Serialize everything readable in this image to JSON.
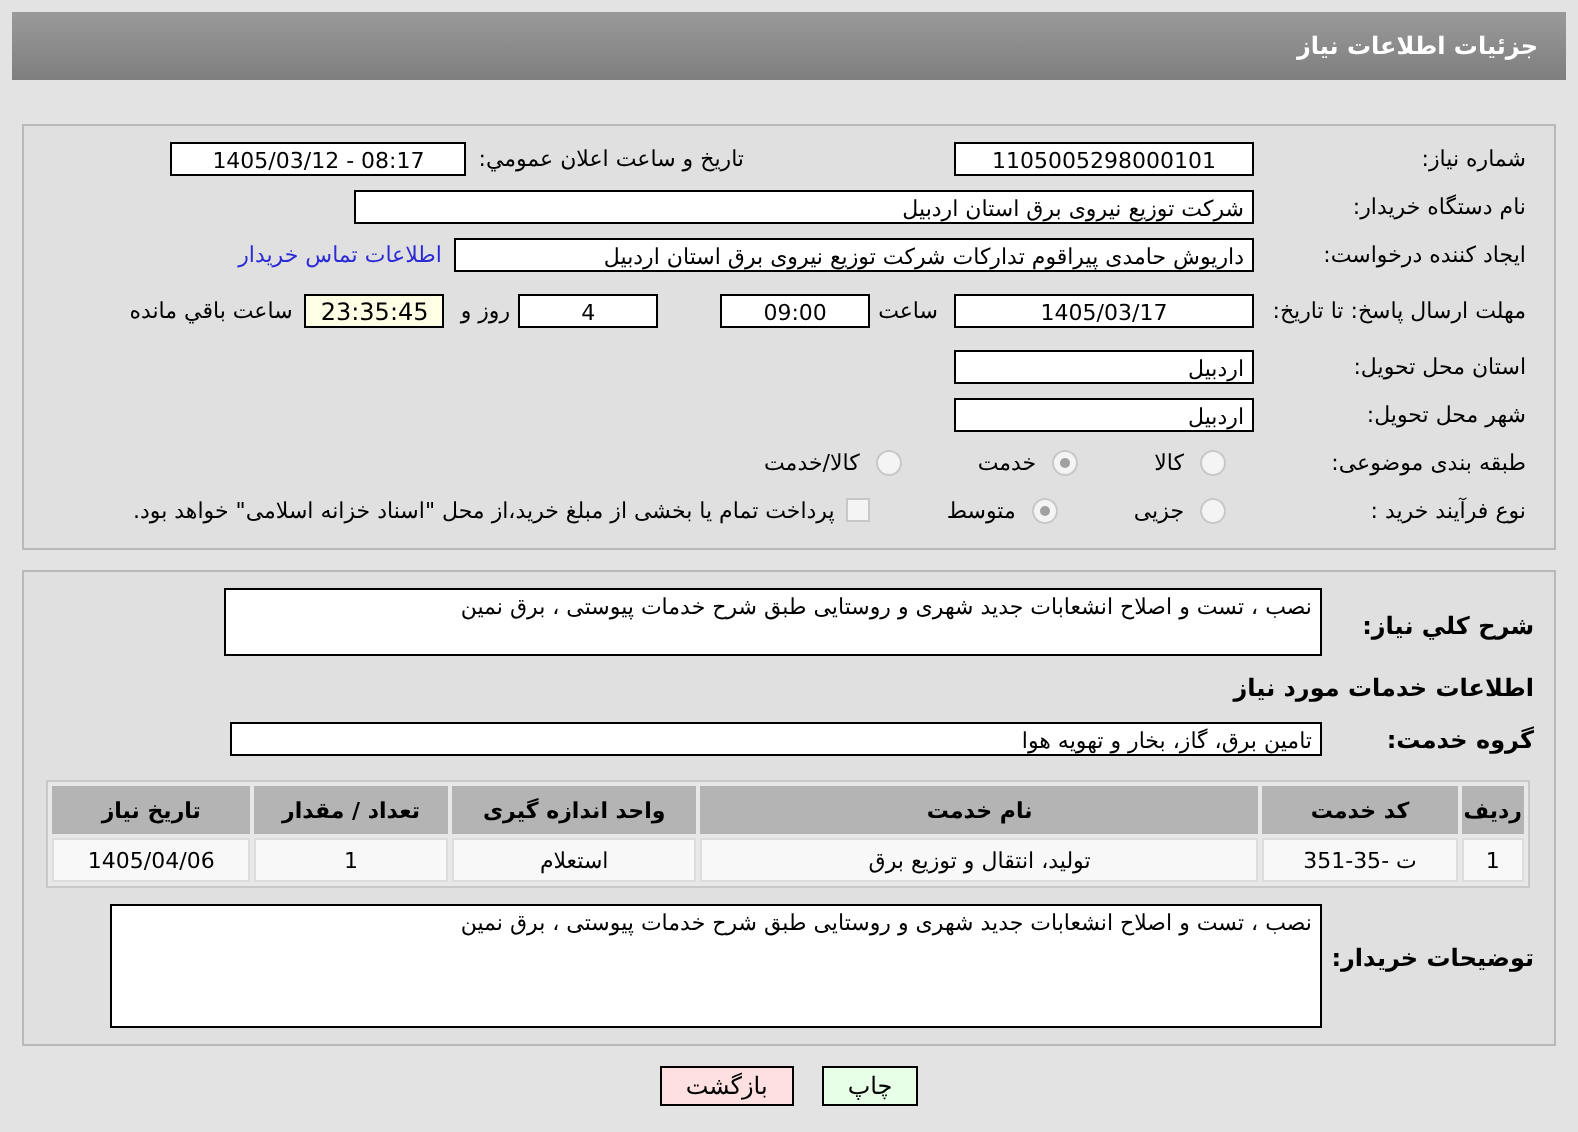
{
  "header": {
    "title": "جزئیات اطلاعات نیاز"
  },
  "details": {
    "need_number": {
      "label": "شماره نیاز:",
      "value": "1105005298000101"
    },
    "announce": {
      "label": "تاریخ و ساعت اعلان عمومي:",
      "value": "1405/03/12 - 08:17"
    },
    "buyer": {
      "label": "نام دستگاه خریدار:",
      "value": "شرکت توزیع نیروی برق استان اردبیل"
    },
    "creator": {
      "label": "ایجاد کننده درخواست:",
      "value": "داریوش حامدی پیراقوم تدارکات شرکت توزیع نیروی برق استان اردبیل",
      "link": "اطلاعات تماس خریدار"
    },
    "deadline": {
      "label": "مهلت ارسال پاسخ: تا تاریخ:",
      "date": "1405/03/17",
      "time_label": "ساعت",
      "time": "09:00",
      "days": "4",
      "days_label": "روز و",
      "remaining": "23:35:45",
      "remaining_label": "ساعت باقي مانده"
    },
    "province": {
      "label": "استان محل تحویل:",
      "value": "اردبیل"
    },
    "city": {
      "label": "شهر محل تحویل:",
      "value": "اردبیل"
    },
    "category": {
      "label": "طبقه بندی موضوعی:",
      "options": [
        {
          "label": "کالا",
          "selected": false
        },
        {
          "label": "خدمت",
          "selected": true
        },
        {
          "label": "کالا/خدمت",
          "selected": false
        }
      ]
    },
    "process": {
      "label": "نوع فرآیند خرید :",
      "options": [
        {
          "label": "جزیی",
          "selected": false
        },
        {
          "label": "متوسط",
          "selected": true
        }
      ],
      "treasury": {
        "label": "پرداخت تمام یا بخشی از مبلغ خرید،از محل \"اسناد خزانه اسلامی\" خواهد بود.",
        "checked": false
      }
    }
  },
  "services": {
    "summary": {
      "label": "شرح کلي نیاز:",
      "value": "نصب ، تست و اصلاح انشعابات جدید شهری و روستایی طبق شرح خدمات پیوستی ، برق نمین"
    },
    "heading": "اطلاعات خدمات مورد نیاز",
    "group": {
      "label": "گروه خدمت:",
      "value": "تامین برق، گاز، بخار و تهویه هوا"
    },
    "table": {
      "columns": [
        "ردیف",
        "کد خدمت",
        "نام خدمت",
        "واحد اندازه گیری",
        "تعداد / مقدار",
        "تاریخ نیاز"
      ],
      "rows": [
        [
          "1",
          "ت -35-351",
          "تولید، انتقال و توزیع برق",
          "استعلام",
          "1",
          "1405/04/06"
        ]
      ]
    },
    "notes": {
      "label": "توضیحات خریدار:",
      "value": "نصب ، تست و اصلاح انشعابات جدید شهری و روستایی طبق شرح خدمات پیوستی ، برق نمین"
    }
  },
  "buttons": [
    {
      "label": "چاپ",
      "kind": "print"
    },
    {
      "label": "بازگشت",
      "kind": "back"
    }
  ]
}
